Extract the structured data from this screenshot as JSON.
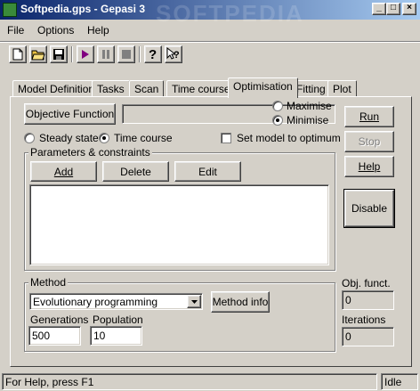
{
  "window": {
    "title": "Softpedia.gps - Gepasi 3",
    "controls": {
      "minimize": "_",
      "maximize": "□",
      "close": "×"
    }
  },
  "menu": [
    "File",
    "Options",
    "Help"
  ],
  "toolbar": {
    "icons": [
      "new-file-icon",
      "open-folder-icon",
      "save-icon",
      "play-icon",
      "pause-icon",
      "stop-icon",
      "help-icon",
      "context-help-icon"
    ]
  },
  "tabs": [
    "Model Definition",
    "Tasks",
    "Scan",
    "Time course",
    "Optimisation",
    "Fitting",
    "Plot"
  ],
  "active_tab": "Optimisation",
  "optimisation": {
    "objective_function_label": "Objective Function",
    "objective_function_value": "",
    "maximise_label": "Maximise",
    "minimise_label": "Minimise",
    "minimise_selected": true,
    "steady_state_label": "Steady state",
    "time_course_label": "Time course",
    "time_course_selected": true,
    "set_model_label": "Set model to optimum",
    "set_model_checked": false,
    "params_group_title": "Parameters & constraints",
    "add_label": "Add",
    "delete_label": "Delete",
    "edit_label": "Edit",
    "run_label": "Run",
    "stop_label": "Stop",
    "help_label": "Help",
    "disable_label": "Disable",
    "method_group_title": "Method",
    "method_value": "Evolutionary programming",
    "method_info_label": "Method info",
    "generations_label": "Generations",
    "generations_value": "500",
    "population_label": "Population",
    "population_value": "10",
    "obj_funct_label": "Obj. funct.",
    "obj_funct_value": "0",
    "iterations_label": "Iterations",
    "iterations_value": "0"
  },
  "status": {
    "help_text": "For Help, press F1",
    "state": "Idle"
  },
  "watermark": "SOFTPEDIA"
}
